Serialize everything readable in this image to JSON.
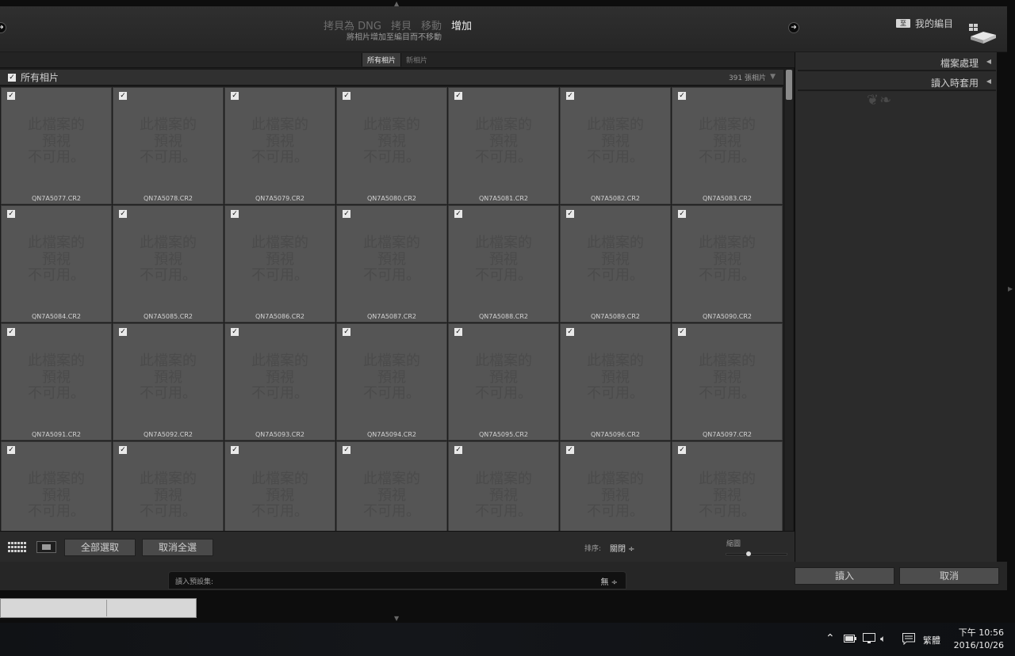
{
  "header": {
    "modes": [
      "拷貝為 DNG",
      "拷貝",
      "移動",
      "增加"
    ],
    "active_mode": "增加",
    "subtitle": "將相片增加至編目而不移動",
    "destination_label": "我的編目",
    "destination_icon_text": "至"
  },
  "filter": {
    "tabs": [
      "所有相片",
      "新相片"
    ]
  },
  "grid": {
    "header_label": "所有相片",
    "count_label": "391 張相片",
    "placeholder": "此檔案的\n預視\n不可用。",
    "items": [
      "QN7A5077.CR2",
      "QN7A5078.CR2",
      "QN7A5079.CR2",
      "QN7A5080.CR2",
      "QN7A5081.CR2",
      "QN7A5082.CR2",
      "QN7A5083.CR2",
      "QN7A5084.CR2",
      "QN7A5085.CR2",
      "QN7A5086.CR2",
      "QN7A5087.CR2",
      "QN7A5088.CR2",
      "QN7A5089.CR2",
      "QN7A5090.CR2",
      "QN7A5091.CR2",
      "QN7A5092.CR2",
      "QN7A5093.CR2",
      "QN7A5094.CR2",
      "QN7A5095.CR2",
      "QN7A5096.CR2",
      "QN7A5097.CR2",
      "",
      "",
      "",
      "",
      "",
      "",
      ""
    ]
  },
  "toolbar": {
    "select_all": "全部選取",
    "deselect_all": "取消全選",
    "sort_label": "排序:",
    "sort_value": "關閉 ÷",
    "thumbnail_label": "縮圖",
    "thumbnail_size": 0.35
  },
  "right_panel": {
    "sections": [
      "檔案處理",
      "讀入時套用"
    ]
  },
  "bottom": {
    "preset_label": "讀入預設集:",
    "preset_value": "無 ÷",
    "import_button": "讀入",
    "cancel_button": "取消"
  },
  "taskbar": {
    "ime": "繁體",
    "time": "下午 10:56",
    "date": "2016/10/26"
  }
}
